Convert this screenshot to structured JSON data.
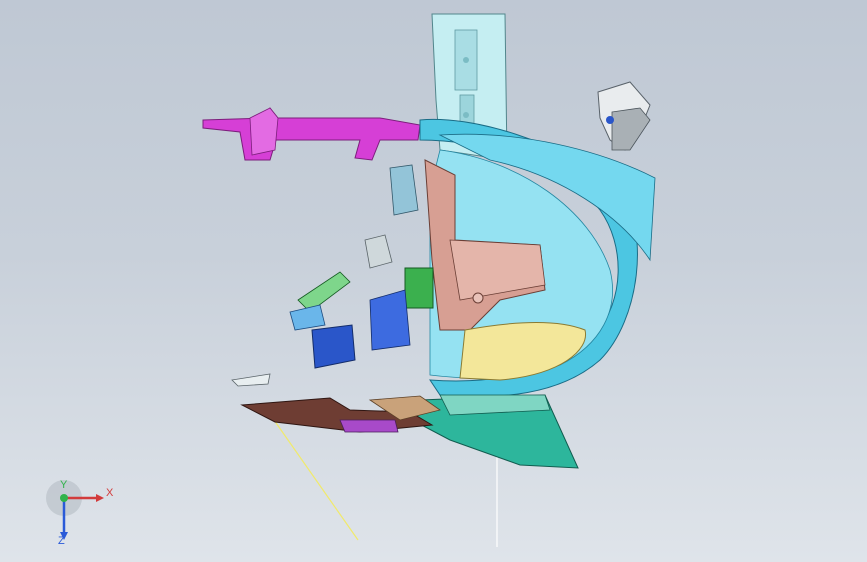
{
  "viewport": {
    "background_top": "#bfc8d4",
    "background_bottom": "#dfe4ea",
    "model_colors": {
      "pillar": "#b9e7ec",
      "cyan": "#5fd1ea",
      "cyan_dark": "#1aa7c8",
      "magenta": "#d63fd6",
      "salmon": "#d99a8f",
      "teal": "#2db69c",
      "yellow": "#f3e79a",
      "green": "#3bb04e",
      "blue": "#2a56c9",
      "brown": "#6e3d33",
      "white": "#eef2f4"
    }
  },
  "triad": {
    "x_label": "X",
    "y_label": "Y",
    "z_label": "Z",
    "x_color": "#d23b3b",
    "y_color": "#31b34a",
    "z_color": "#2a5ad8"
  }
}
